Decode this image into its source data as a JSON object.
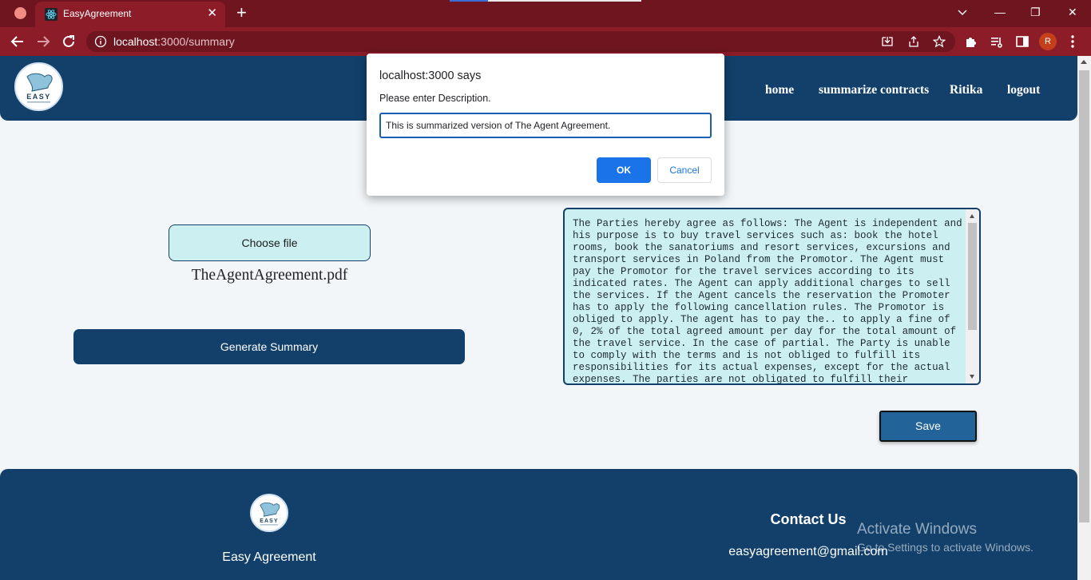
{
  "browser": {
    "tab_title": "EasyAgreement",
    "tab_close": "✕",
    "new_tab": "+",
    "url_host": "localhost",
    "url_path": ":3000/summary",
    "avatar_initial": "R",
    "window_controls": {
      "minimize": "—",
      "restore": "❐",
      "close": "✕"
    }
  },
  "header": {
    "logo_text": "EASY",
    "nav": {
      "home": "home",
      "summarize": "summarize contracts",
      "user": "Ritika",
      "logout": "logout"
    }
  },
  "main": {
    "choose_file_label": "Choose file",
    "file_name": "TheAgentAgreement.pdf",
    "generate_label": "Generate Summary",
    "summary_text": "The Parties hereby agree as follows: The Agent is independent and\nhis purpose is to buy travel services such as: book the hotel\nrooms, book the sanatoriums and resort services, excursions and\ntransport services in Poland from the Promotor. The Agent must\npay the Promotor for the travel services according to its\nindicated rates. The Agent can apply additional charges to sell\nthe services. If the Agent cancels the reservation the Promoter\nhas to apply the following cancellation rules. The Promotor is\nobliged to apply. The agent has to pay the.. to apply a fine of\n0, 2% of the total agreed amount per day for the total amount of\nthe travel service. In the case of partial. The Party is unable\nto comply with the terms and is not obliged to fulfill its\nresponsibilities for its actual expenses, except for the actual\nexpenses. The parties are not obligated to fulfill their",
    "save_label": "Save"
  },
  "footer": {
    "logo_text": "EASY",
    "brand": "Easy Agreement",
    "contact_heading": "Contact Us",
    "email": "easyagreement@gmail.com"
  },
  "watermark": {
    "line1": "Activate Windows",
    "line2": "Go to Settings to activate Windows."
  },
  "dialog": {
    "title": "localhost:3000 says",
    "message": "Please enter Description.",
    "input_value": "This is summarized version of The Agent Agreement.",
    "ok_label": "OK",
    "cancel_label": "Cancel"
  },
  "colors": {
    "chrome_tabbar": "#6e1520",
    "chrome_toolbar": "#8b1c28",
    "brand_navy": "#12406a",
    "summary_bg": "#ccf0f1",
    "save_blue": "#22649a",
    "dialog_ok": "#1a73e8"
  }
}
